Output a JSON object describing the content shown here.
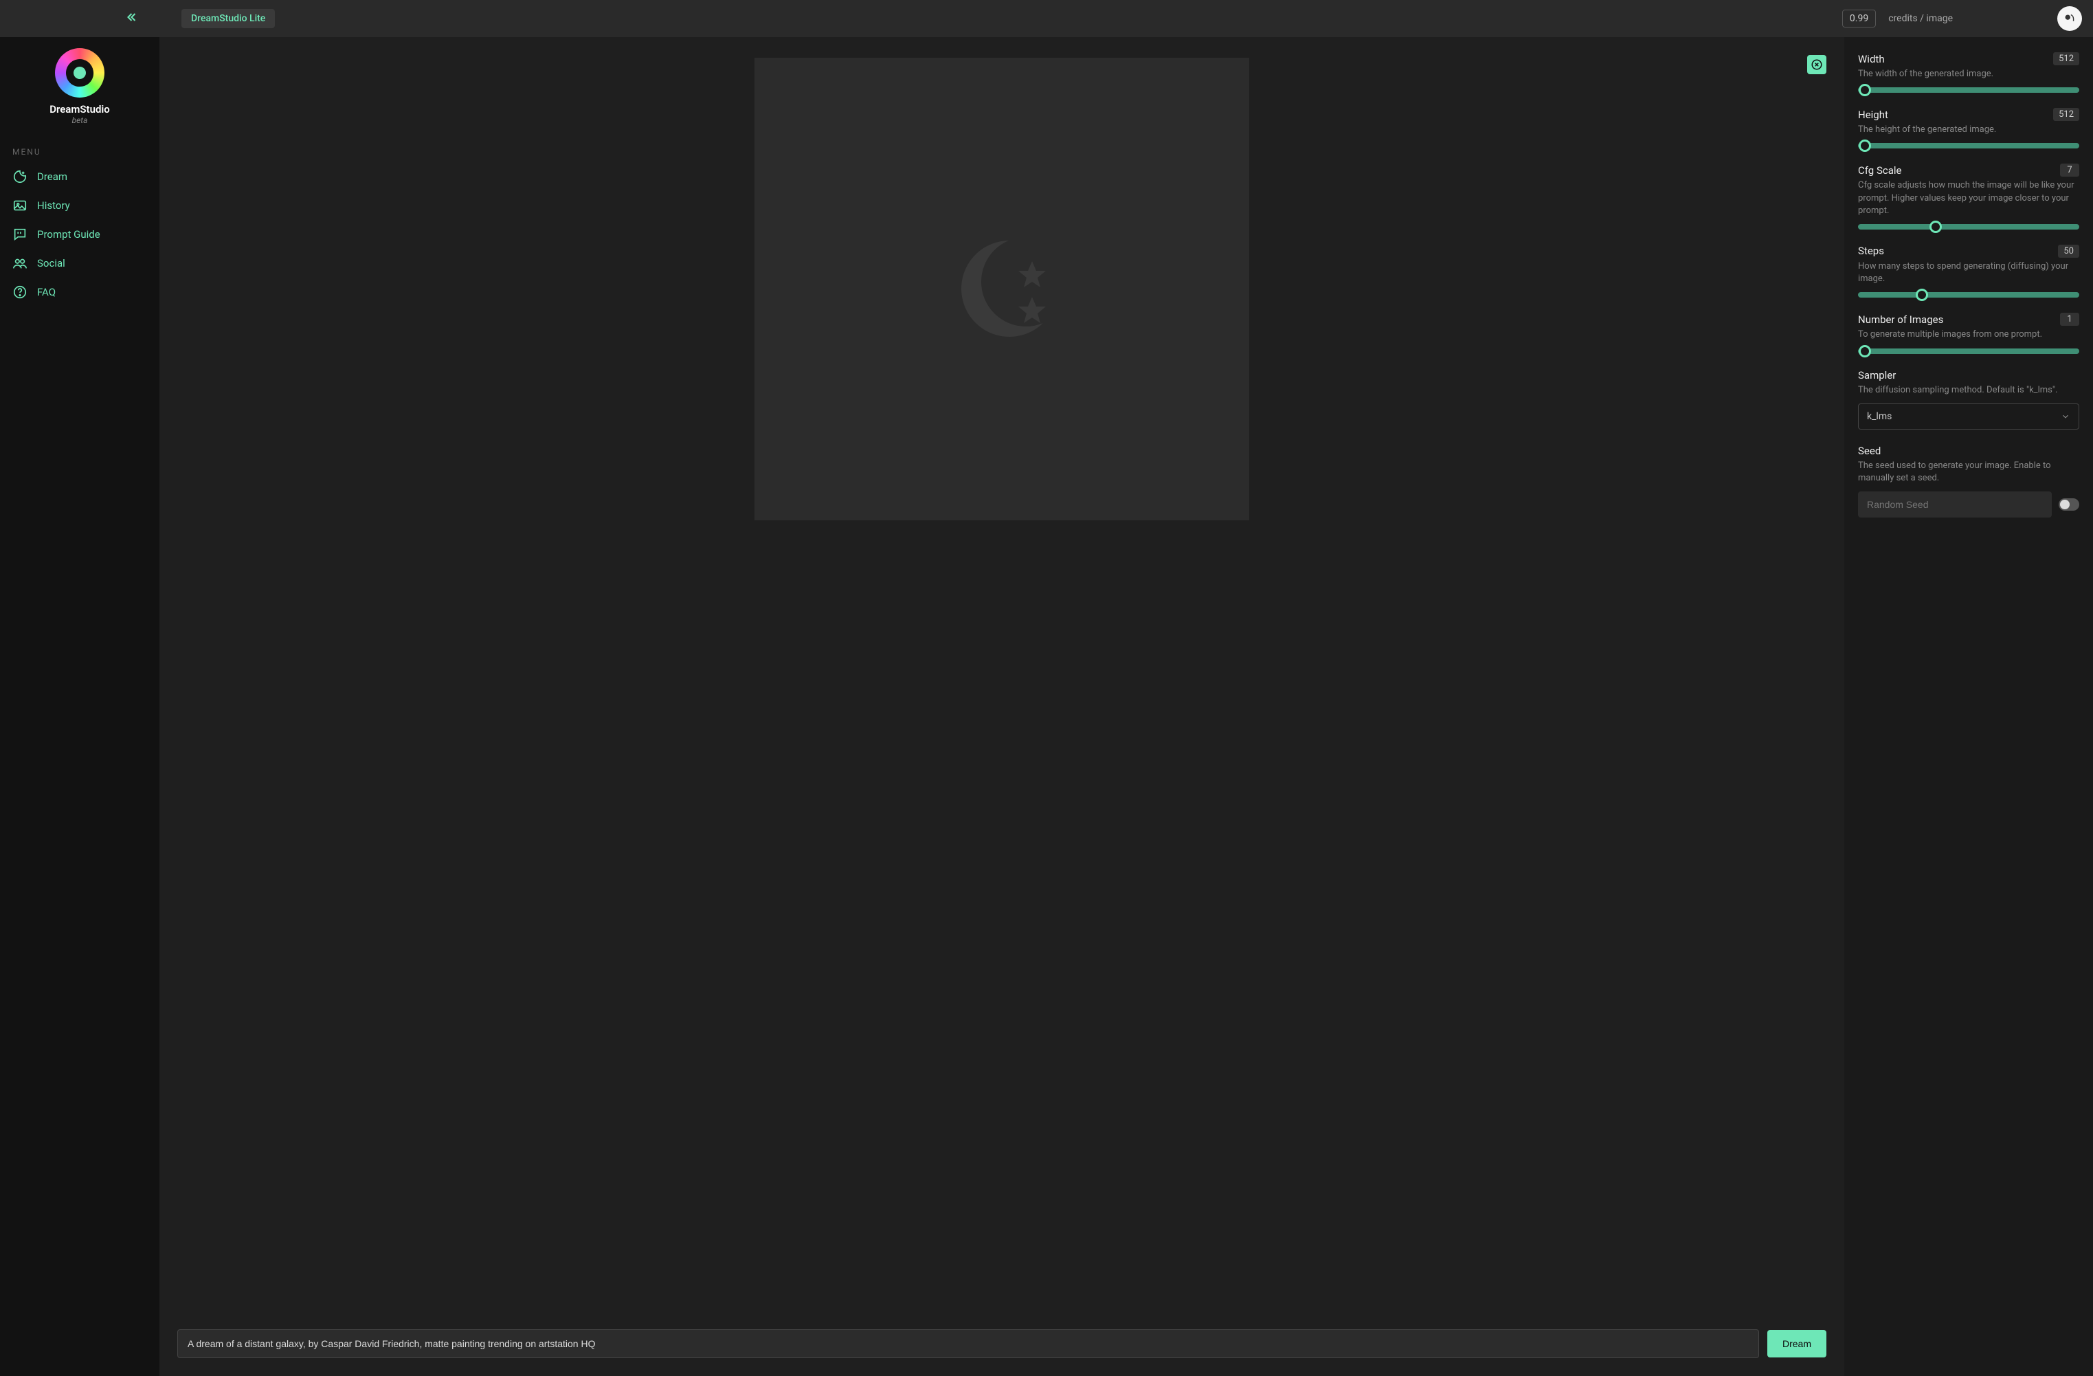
{
  "topbar": {
    "lite_badge": "DreamStudio Lite",
    "credits_value": "0.99",
    "credits_label": "credits / image"
  },
  "brand": {
    "title": "DreamStudio",
    "subtitle": "beta"
  },
  "menu": {
    "header": "MENU",
    "items": [
      {
        "label": "Dream",
        "icon": "moon-plus"
      },
      {
        "label": "History",
        "icon": "image"
      },
      {
        "label": "Prompt Guide",
        "icon": "chat-quote"
      },
      {
        "label": "Social",
        "icon": "users"
      },
      {
        "label": "FAQ",
        "icon": "help-circle"
      }
    ]
  },
  "prompt": {
    "value": "A dream of a distant galaxy, by Caspar David Friedrich, matte painting trending on artstation HQ",
    "button": "Dream"
  },
  "settings": {
    "width": {
      "title": "Width",
      "value": "512",
      "desc": "The width of the generated image.",
      "pct": 0
    },
    "height": {
      "title": "Height",
      "value": "512",
      "desc": "The height of the generated image.",
      "pct": 0
    },
    "cfg": {
      "title": "Cfg Scale",
      "value": "7",
      "desc": "Cfg scale adjusts how much the image will be like your prompt. Higher values keep your image closer to your prompt.",
      "pct": 35
    },
    "steps": {
      "title": "Steps",
      "value": "50",
      "desc": "How many steps to spend generating (diffusing) your image.",
      "pct": 29
    },
    "num": {
      "title": "Number of Images",
      "value": "1",
      "desc": "To generate multiple images from one prompt.",
      "pct": 0
    },
    "sampler": {
      "title": "Sampler",
      "desc": "The diffusion sampling method. Default is \"k_lms\".",
      "selected": "k_lms"
    },
    "seed": {
      "title": "Seed",
      "desc": "The seed used to generate your image. Enable to manually set a seed.",
      "placeholder": "Random Seed"
    }
  }
}
